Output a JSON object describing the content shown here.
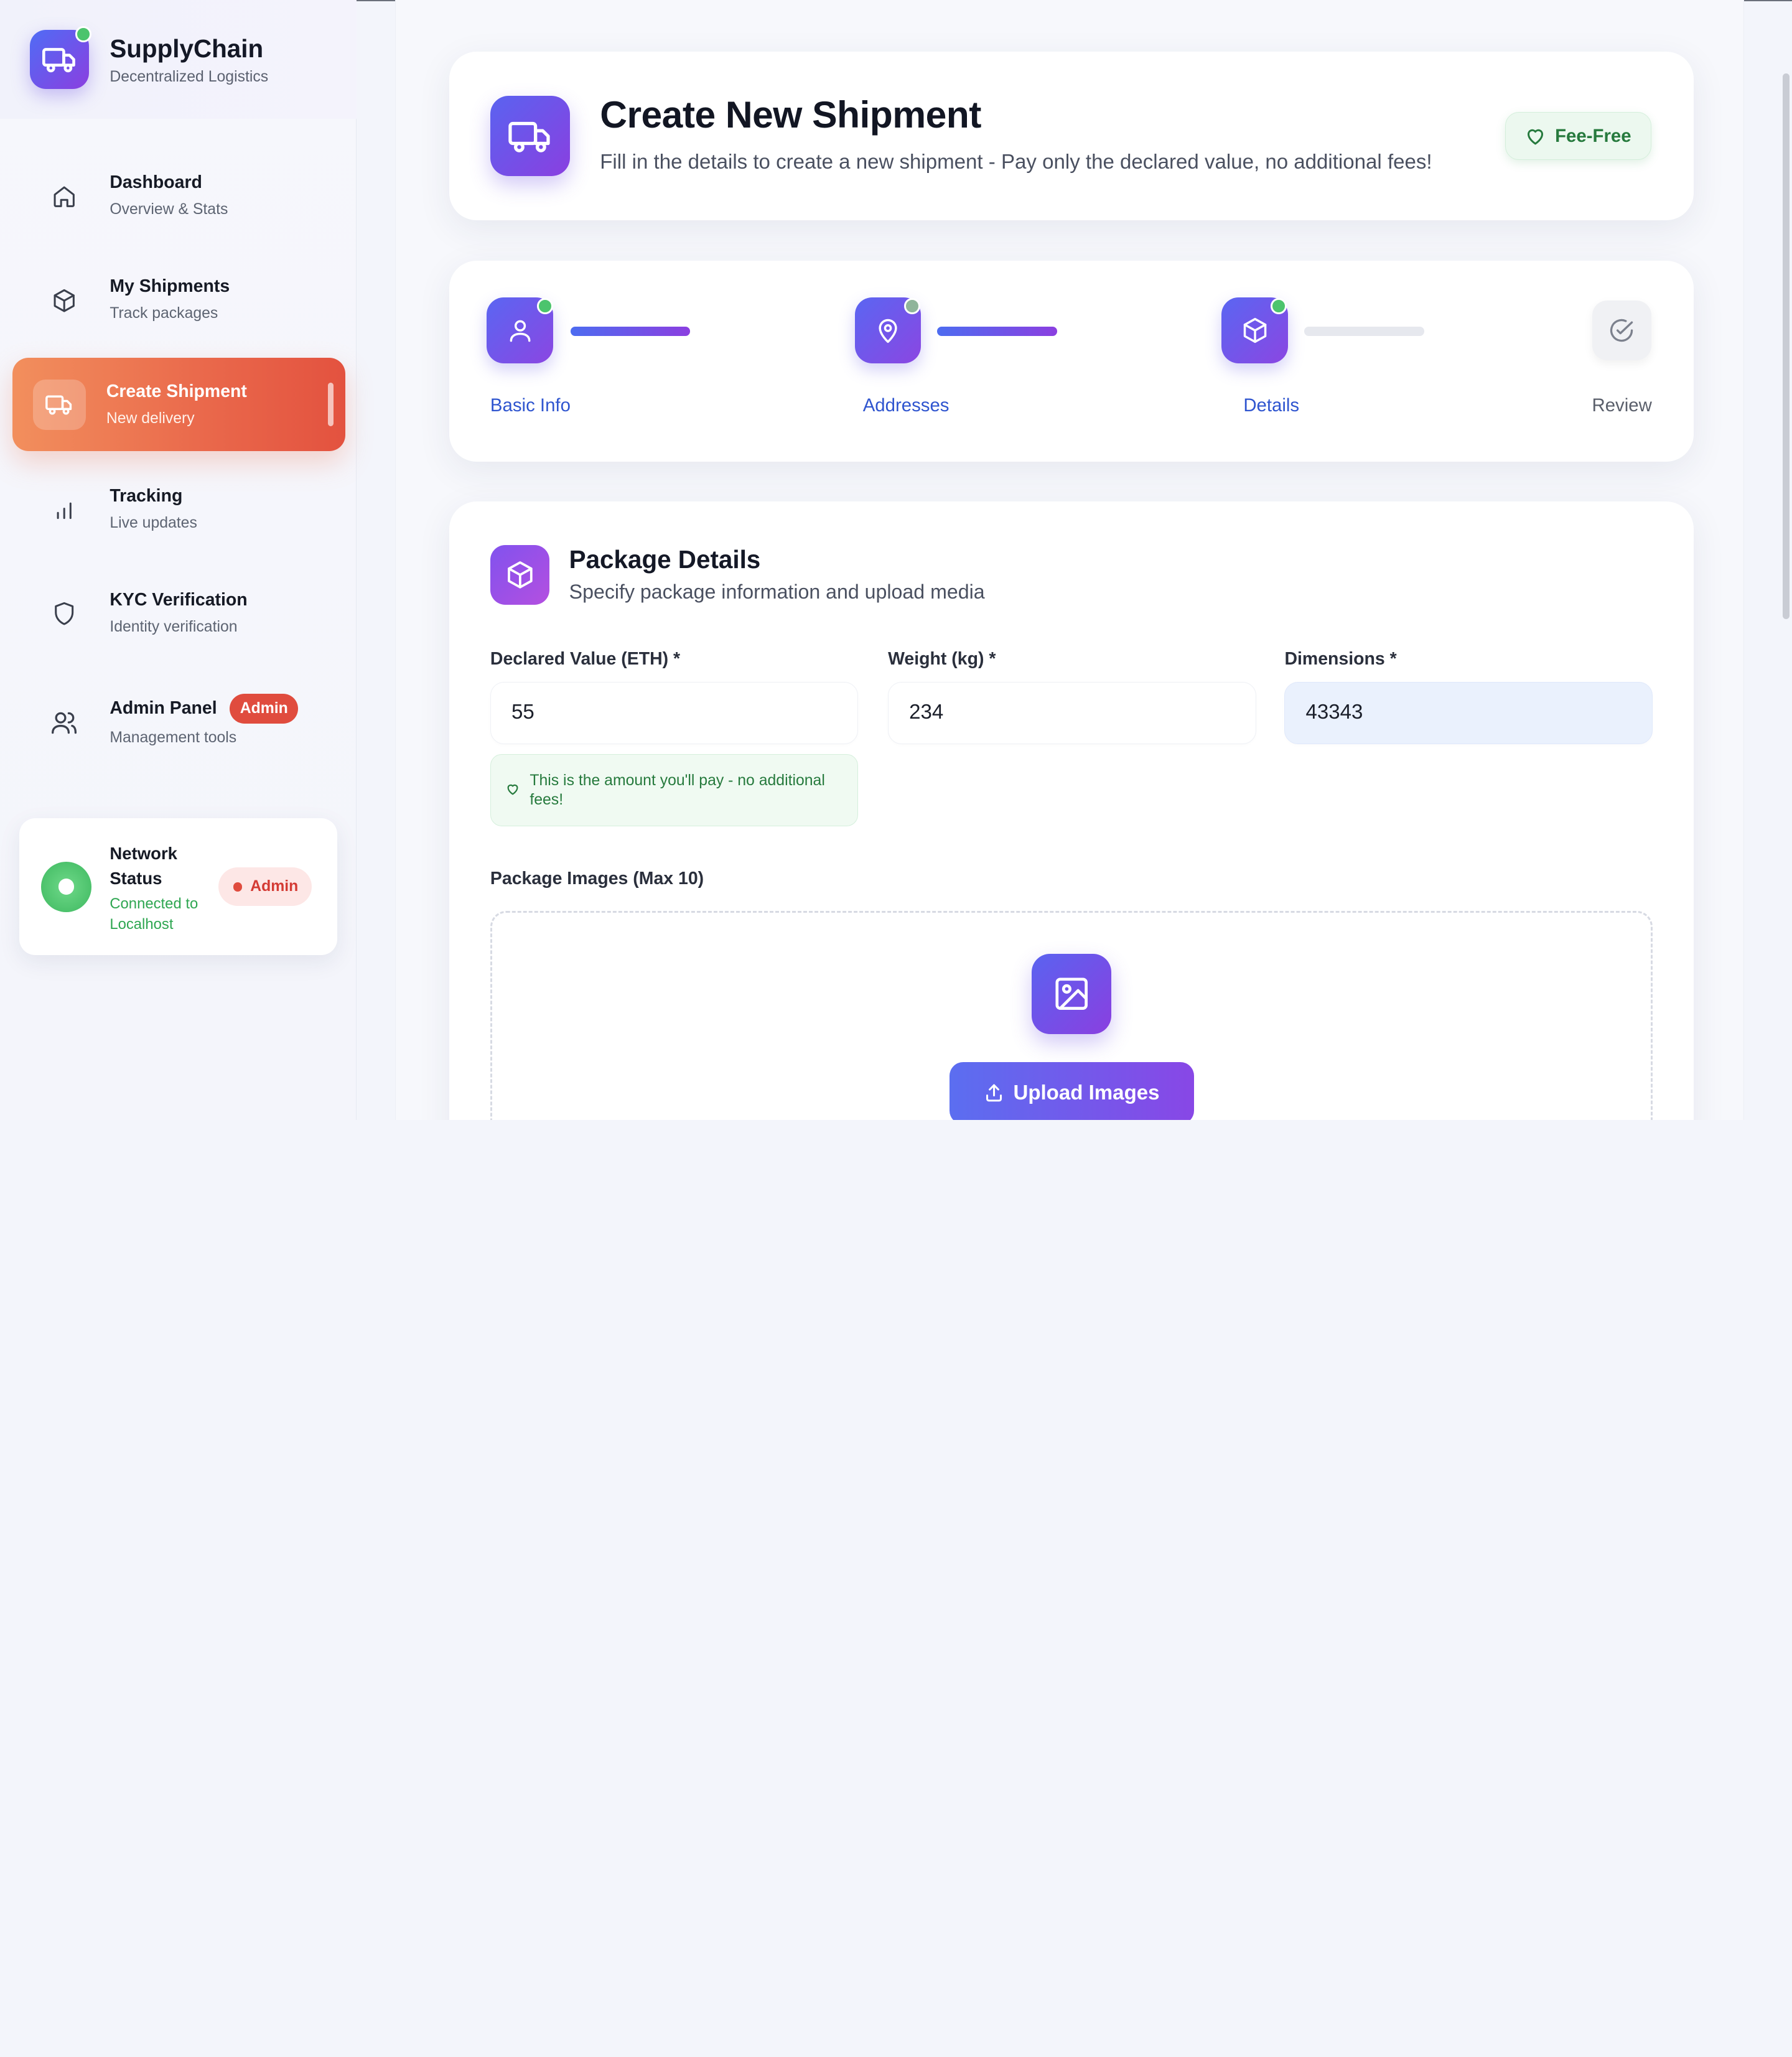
{
  "brand": {
    "name": "SupplyChain",
    "subtitle": "Decentralized Logistics"
  },
  "nav": [
    {
      "title": "Dashboard",
      "subtitle": "Overview & Stats",
      "icon": "home-icon"
    },
    {
      "title": "My Shipments",
      "subtitle": "Track packages",
      "icon": "package-icon"
    },
    {
      "title": "Create Shipment",
      "subtitle": "New delivery",
      "icon": "truck-icon",
      "active": true
    },
    {
      "title": "Tracking",
      "subtitle": "Live updates",
      "icon": "bar-chart-icon"
    },
    {
      "title": "KYC Verification",
      "subtitle": "Identity verification",
      "icon": "shield-icon"
    },
    {
      "title": "Admin Panel",
      "subtitle": "Management tools",
      "icon": "users-icon",
      "badge": "Admin"
    }
  ],
  "network": {
    "title": "Network Status",
    "status": "Connected to Localhost",
    "role": "Admin"
  },
  "header": {
    "title": "Create New Shipment",
    "subtitle": "Fill in the details to create a new shipment - Pay only the declared value, no additional fees!",
    "badge": "Fee-Free"
  },
  "steps": [
    {
      "label": "Basic Info",
      "icon": "user-icon",
      "complete": true
    },
    {
      "label": "Addresses",
      "icon": "map-pin-icon",
      "complete": true
    },
    {
      "label": "Details",
      "icon": "package-icon",
      "complete": true
    },
    {
      "label": "Review",
      "icon": "check-circle-icon",
      "complete": false
    }
  ],
  "package": {
    "title": "Package Details",
    "subtitle": "Specify package information and upload media",
    "fields": {
      "declared_value": {
        "label": "Declared Value (ETH) *",
        "value": "55"
      },
      "weight": {
        "label": "Weight (kg) *",
        "value": "234"
      },
      "dimensions": {
        "label": "Dimensions *",
        "value": "43343"
      }
    },
    "hint": "This is the amount you'll pay - no additional fees!",
    "images_label": "Package Images (Max 10)",
    "upload_label": "Upload Images"
  },
  "colors": {
    "accent": "#6b55ea",
    "active_nav": "#ea6a4c",
    "success": "#3db85f",
    "danger": "#e04c3e"
  }
}
